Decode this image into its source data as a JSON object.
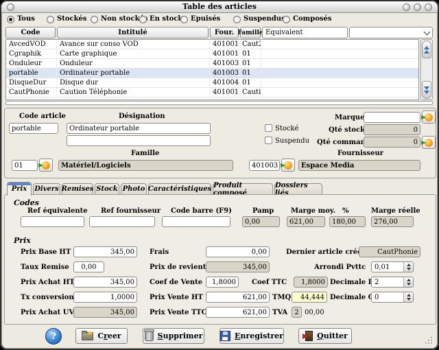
{
  "window": {
    "title": "Table des articles"
  },
  "filters": {
    "options": [
      {
        "label": "Tous",
        "selected": true
      },
      {
        "label": "Stockés",
        "selected": false
      },
      {
        "label": "Non stockés",
        "selected": false
      },
      {
        "label": "En stock",
        "selected": false
      },
      {
        "label": "Epuisés",
        "selected": false
      },
      {
        "label": "Suspendus",
        "selected": false
      },
      {
        "label": "Composés",
        "selected": false
      }
    ]
  },
  "table": {
    "columns": {
      "code": "Code",
      "intitule": "Intitulé",
      "four": "Four.",
      "famille": "Famille",
      "equivalent": "Equivalent"
    },
    "rows": [
      {
        "code": "AvcedVOD",
        "intitule": "Avance sur conso VOD",
        "four": "401001",
        "famille": "Caut2",
        "equivalent": "",
        "selected": false
      },
      {
        "code": "Cgraphik",
        "intitule": "Carte graphique",
        "four": "401001",
        "famille": "01",
        "equivalent": "",
        "selected": false
      },
      {
        "code": "Onduleur",
        "intitule": "Onduleur",
        "four": "401003",
        "famille": "01",
        "equivalent": "",
        "selected": false
      },
      {
        "code": "portable",
        "intitule": "Ordinateur portable",
        "four": "401003",
        "famille": "01",
        "equivalent": "",
        "selected": true
      },
      {
        "code": "DisqueDur",
        "intitule": "Disque dur",
        "four": "401004",
        "famille": "01",
        "equivalent": "",
        "selected": false
      },
      {
        "code": "CautPhonie",
        "intitule": "Caution Téléphonie",
        "four": "401001",
        "famille": "Cauti",
        "equivalent": "",
        "selected": false
      }
    ]
  },
  "details": {
    "code_article_label": "Code article",
    "code_article": "portable",
    "designation_label": "Désignation",
    "designation": "Ordinateur portable",
    "designation2": "",
    "stocke_label": "Stocké",
    "suspendu_label": "Suspendu",
    "marque_label": "Marque",
    "marque": "",
    "qte_stock_label": "Qté stock",
    "qte_stock": "0",
    "qte_commande_label": "Qté commande",
    "qte_commande": "0",
    "famille_label": "Famille",
    "famille_code": "01",
    "famille_name": "Matériel/Logiciels",
    "fournisseur_label": "Fournisseur",
    "fournisseur_code": "401003",
    "fournisseur_name": "Espace Media"
  },
  "tabs": {
    "items": [
      {
        "label": "Prix",
        "active": true
      },
      {
        "label": "Divers",
        "active": false
      },
      {
        "label": "Remises",
        "active": false
      },
      {
        "label": "Stock",
        "active": false
      },
      {
        "label": "Photo",
        "active": false
      },
      {
        "label": "Caractéristiques",
        "active": false
      },
      {
        "label": "Produit composé",
        "active": false
      },
      {
        "label": "Dossiers liés",
        "active": false
      }
    ]
  },
  "codes": {
    "title": "Codes",
    "ref_equivalente_label": "Ref équivalente",
    "ref_equivalente": "",
    "ref_fournisseur_label": "Ref fournisseur",
    "ref_fournisseur": "",
    "code_barre_label": "Code barre (F9)",
    "code_barre": "",
    "pamp_label": "Pamp",
    "pamp": "0,00",
    "marge_moy_label": "Marge moy.",
    "marge_moy": "621,00",
    "pct_label": "%",
    "pct": "180,00",
    "marge_reelle_label": "Marge réelle",
    "marge_reelle": "276,00"
  },
  "prix": {
    "title": "Prix",
    "prix_base_ht_label": "Prix Base HT",
    "prix_base_ht": "345,00",
    "frais_label": "Frais",
    "frais": "0,00",
    "dernier_article_label": "Dernier article crée",
    "dernier_article": "CautPhonie",
    "taux_remise_label": "Taux Remise",
    "taux_remise": "0,00",
    "prix_revient_label": "Prix de revient",
    "prix_revient": "345,00",
    "arrondi_label": "Arrondi Pvttc",
    "arrondi": "0,01",
    "prix_achat_ht_label": "Prix Achat HT",
    "prix_achat_ht": "345,00",
    "coef_vente_label": "Coef de Vente",
    "coef_vente": "1,8000",
    "coef_ttc_label": "Coef TTC",
    "coef_ttc": "1,8000",
    "decimale_prix_label": "Decimale Prix",
    "decimale_prix": "2",
    "tx_conversion_label": "Tx conversion",
    "tx_conversion": "1,0000",
    "prix_vente_ht_label": "Prix Vente HT",
    "prix_vente_ht": "621,00",
    "tmq_label": "TMQ",
    "tmq": "44,444",
    "decimale_qte_label": "Decimale Qté",
    "decimale_qte": "0",
    "prix_achat_uv_label": "Prix Achat UV",
    "prix_achat_uv": "345,00",
    "prix_vente_ttc_label": "Prix Vente TTC",
    "prix_vente_ttc": "621,00",
    "tva_label": "TVA",
    "tva_code": "2",
    "tva_value": "00,00"
  },
  "actions": {
    "help": "?",
    "creer": {
      "pre": "C",
      "mn": "r",
      "post": "eer"
    },
    "supprimer": {
      "pre": "",
      "mn": "S",
      "post": "upprimer"
    },
    "enregistrer": {
      "pre": "",
      "mn": "E",
      "post": "nregistrer"
    },
    "quitter": {
      "pre": "",
      "mn": "Q",
      "post": "uitter"
    }
  },
  "colors": {
    "accent_blue": "#5a87c6",
    "lookup_orange": "#f5a623",
    "arrow_green": "#2e8f2e",
    "selected_row": "#dbe5f5",
    "tmq_field_yellow": "#ffffcf",
    "readonly_field": "#d9d5c9"
  }
}
